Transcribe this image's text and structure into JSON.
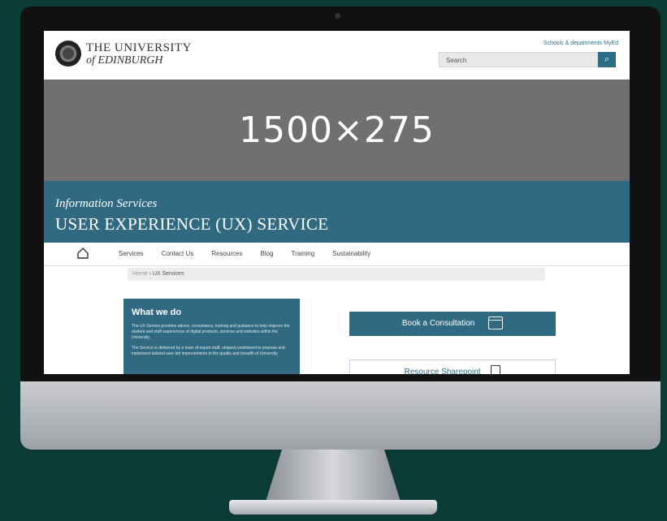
{
  "header": {
    "university_line1": "THE UNIVERSITY",
    "university_line2": "of EDINBURGH",
    "top_links": "Schools & departments  MyEd",
    "search_placeholder": "Search"
  },
  "banner": {
    "text": "1500×275"
  },
  "service": {
    "subtitle": "Information Services",
    "title": "USER EXPERIENCE (UX) SERVICE"
  },
  "nav": {
    "items": [
      "Services",
      "Contact Us",
      "Resources",
      "Blog",
      "Training",
      "Sustainability"
    ]
  },
  "breadcrumb": {
    "home": "Home",
    "sep": "›",
    "current": "UX Services"
  },
  "what_we_do": {
    "heading": "What we do",
    "para1": "The UX Service provides advice, consultancy, training and guidance to help improve the student and staff experiences of digital products, services and websites within the University.",
    "para2": "The Service is delivered by a team of expert staff, uniquely positioned to propose and implement tailored user-led improvements to the quality and breadth of University"
  },
  "actions": {
    "consult": "Book a Consultation",
    "sharepoint": "Resource Sharepoint"
  },
  "colors": {
    "accent": "#2f6a82",
    "background": "#0b3b37"
  }
}
